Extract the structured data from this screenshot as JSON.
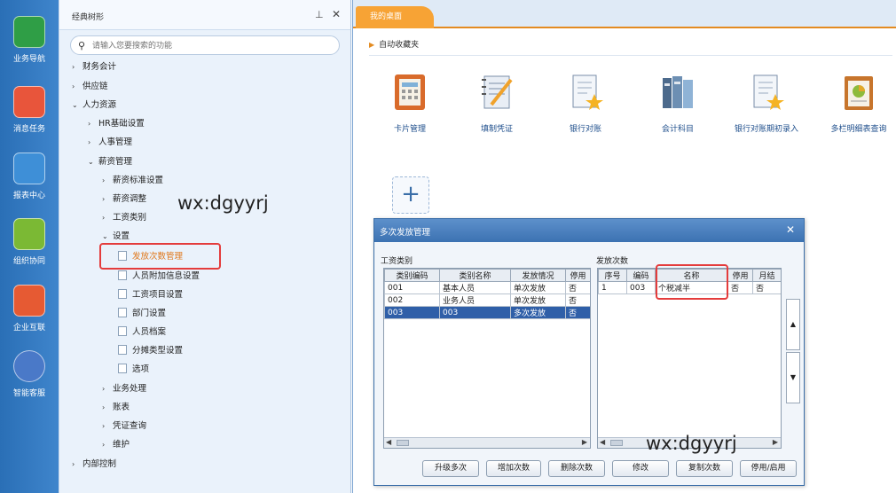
{
  "rail": {
    "items": [
      {
        "label": "业务导航",
        "color": "#2f9e46"
      },
      {
        "label": "消息任务",
        "color": "#e8553b"
      },
      {
        "label": "报表中心",
        "color": "#3e8fd7"
      },
      {
        "label": "组织协同",
        "color": "#7bb934"
      },
      {
        "label": "企业互联",
        "color": "#e65a33"
      },
      {
        "label": "智能客服",
        "color": "#4a79c8"
      }
    ]
  },
  "tree": {
    "title": "经典树形",
    "pin": "⊥",
    "close": "✕",
    "search_placeholder": "请输入您要搜索的功能",
    "nodes": [
      {
        "label": "财务会计",
        "arrow": "›"
      },
      {
        "label": "供应链",
        "arrow": "›"
      },
      {
        "label": "人力资源",
        "arrow": "⌄"
      },
      {
        "label": "HR基础设置",
        "arrow": "›"
      },
      {
        "label": "人事管理",
        "arrow": "›"
      },
      {
        "label": "薪资管理",
        "arrow": "⌄"
      },
      {
        "label": "薪资标准设置",
        "arrow": "›"
      },
      {
        "label": "薪资调整",
        "arrow": "›"
      },
      {
        "label": "工资类别",
        "arrow": "›"
      },
      {
        "label": "设置",
        "arrow": "⌄"
      },
      {
        "label": "发放次数管理",
        "arrow": ""
      },
      {
        "label": "人员附加信息设置",
        "arrow": ""
      },
      {
        "label": "工资项目设置",
        "arrow": ""
      },
      {
        "label": "部门设置",
        "arrow": ""
      },
      {
        "label": "人员档案",
        "arrow": ""
      },
      {
        "label": "分摊类型设置",
        "arrow": ""
      },
      {
        "label": "选项",
        "arrow": ""
      },
      {
        "label": "业务处理",
        "arrow": "›"
      },
      {
        "label": "账表",
        "arrow": "›"
      },
      {
        "label": "凭证查询",
        "arrow": "›"
      },
      {
        "label": "维护",
        "arrow": "›"
      },
      {
        "label": "内部控制",
        "arrow": "›"
      }
    ],
    "highlight_color": "#e0771a"
  },
  "workspace": {
    "tab_label": "我的桌面",
    "fav_title": "自动收藏夹",
    "apps": [
      {
        "label": "卡片管理",
        "icon": "calculator-icon"
      },
      {
        "label": "填制凭证",
        "icon": "notebook-pen-icon"
      },
      {
        "label": "银行对账",
        "icon": "document-star-icon"
      },
      {
        "label": "会计科目",
        "icon": "books-icon"
      },
      {
        "label": "银行对账期初录入",
        "icon": "document-star-icon"
      },
      {
        "label": "多栏明细表查询",
        "icon": "report-chart-icon"
      }
    ],
    "add_label": "+"
  },
  "dialog": {
    "title": "多次发放管理",
    "close": "✕",
    "left_group_label": "工资类别",
    "left_columns": [
      "类别编码",
      "类别名称",
      "发放情况",
      "停用"
    ],
    "left_rows": [
      [
        "001",
        "基本人员",
        "单次发放",
        "否"
      ],
      [
        "002",
        "业务人员",
        "单次发放",
        "否"
      ],
      [
        "003",
        "003",
        "多次发放",
        "否"
      ]
    ],
    "right_group_label": "发放次数",
    "right_columns": [
      "序号",
      "编码",
      "名称",
      "停用",
      "月结"
    ],
    "right_rows": [
      [
        "1",
        "003",
        "个税减半",
        "否",
        "否"
      ]
    ],
    "buttons": [
      "升级多次",
      "增加次数",
      "删除次数",
      "修改",
      "复制次数",
      "停用/启用"
    ],
    "scroll_up": "▲",
    "scroll_down": "▼",
    "selected_color": "#2f5fa8"
  },
  "watermarks": [
    "wx:dgyyrj",
    "wx:dgyyrj"
  ],
  "annotation_color": "#e43c3c"
}
